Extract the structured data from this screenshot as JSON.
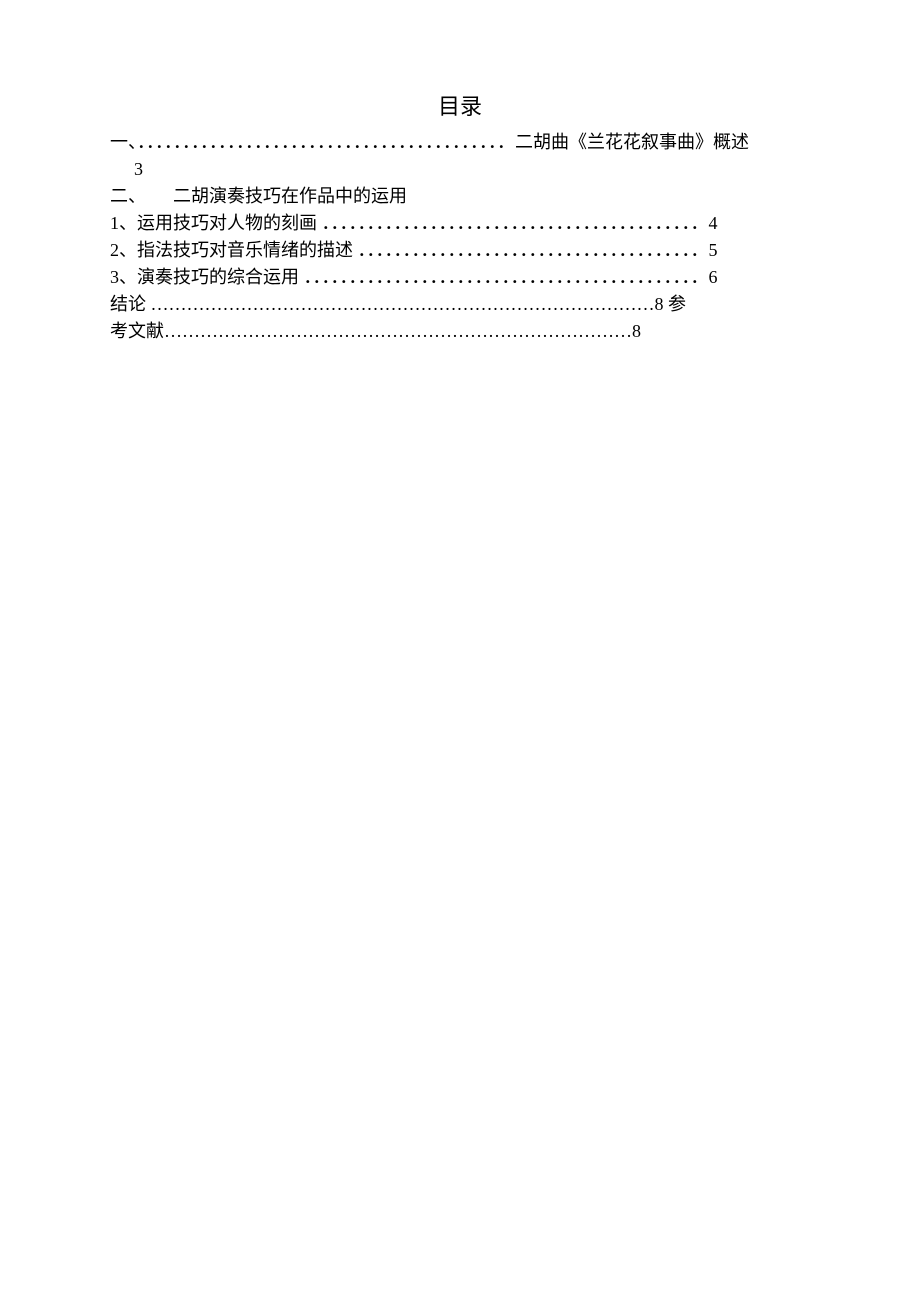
{
  "title": "目录",
  "lines": {
    "l1": "一、．．．．．．．．．．．．．．．．．．．．．．．．．．．．．．．．．．．．．．．．．二胡曲《兰花花叙事曲》概述",
    "l2": "3",
    "l3": "二、　　二胡演奏技巧在作品中的运用",
    "l4": "1、运用技巧对人物的刻画 ．．．．．．．．．．．．．．．．．．．．．．．．．．．．．．．．．．．．．．．．．．4",
    "l5": "2、指法技巧对音乐情绪的描述 ．．．．．．．．．．．．．．．．．．．．．．．．．．．．．．．．．．．．．．5",
    "l6": "3、演奏技巧的综合运用 ．．．．．．．．．．．．．．．．．．．．．．．．．．．．．．．．．．．．．．．．．．．．6",
    "l7": "结论 …………………………………………………………………………8 参",
    "l8": "考文献……………………………………………………………………8"
  }
}
